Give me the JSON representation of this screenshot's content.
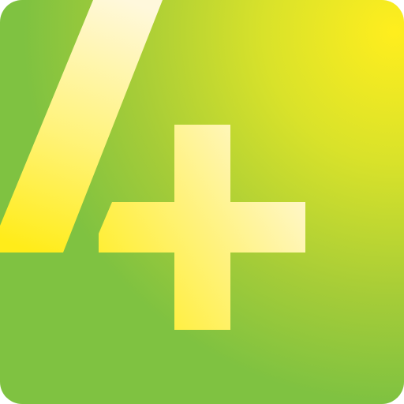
{
  "icon": {
    "name": "4-plus-app-icon",
    "colors": {
      "background_base": "#7fc241",
      "background_highlight": "#ffee1e",
      "figure_light": "#fff8dc",
      "figure_bright": "#ffee2a"
    }
  }
}
